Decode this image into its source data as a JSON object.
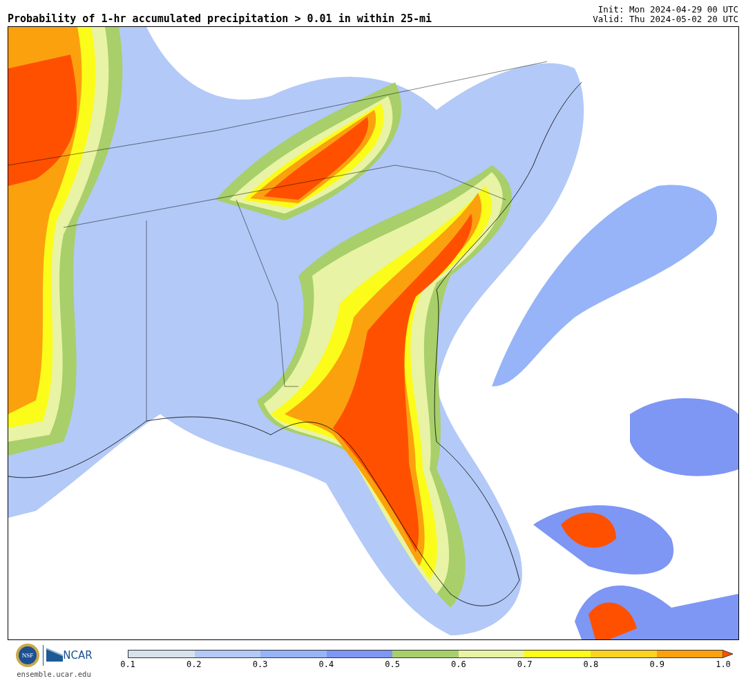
{
  "title": "Probability of 1-hr accumulated precipitation > 0.01 in within 25-mi",
  "init": "Init: Mon 2024-04-29 00 UTC",
  "valid": "Valid: Thu 2024-05-02 20 UTC",
  "branding": {
    "seal_text": "NSF",
    "logo_text": "NCAR",
    "url": "ensemble.ucar.edu"
  },
  "colorbar": {
    "segments": [
      {
        "color": "#d6e2ee"
      },
      {
        "color": "#b3c9f7"
      },
      {
        "color": "#96b4f7"
      },
      {
        "color": "#7e96f4"
      },
      {
        "color": "#a8cf6a"
      },
      {
        "color": "#e8f3a5"
      },
      {
        "color": "#fcfc1a"
      },
      {
        "color": "#fcd420"
      },
      {
        "color": "#fba10e"
      }
    ],
    "extend_arrow": {
      "color": "#ff5000"
    },
    "ticks": [
      "0.1",
      "0.2",
      "0.3",
      "0.4",
      "0.5",
      "0.6",
      "0.7",
      "0.8",
      "0.9",
      "1.0"
    ]
  }
}
